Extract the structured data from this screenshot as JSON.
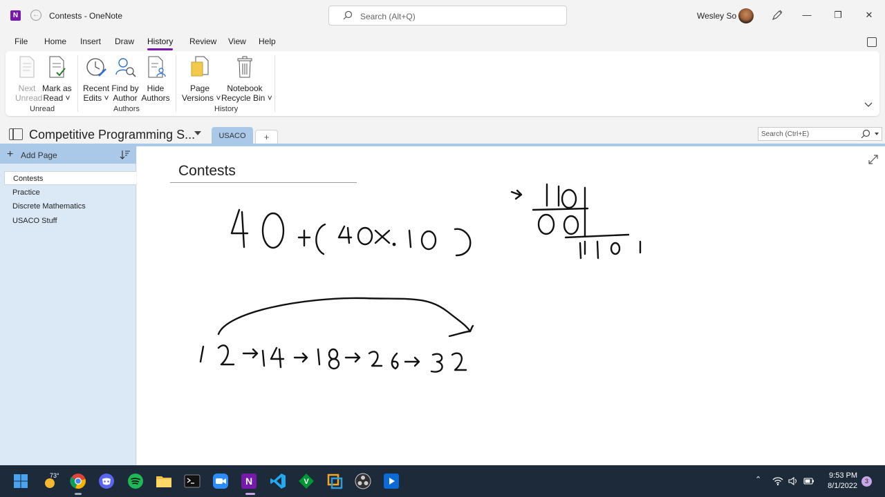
{
  "titlebar": {
    "app_icon_letter": "N",
    "title": "Contests  -  OneNote",
    "search_placeholder": "Search (Alt+Q)",
    "user_name": "Wesley So",
    "minimize": "—",
    "restore": "❐",
    "close": "✕"
  },
  "ribbon_tabs": [
    "File",
    "Home",
    "Insert",
    "Draw",
    "History",
    "Review",
    "View",
    "Help"
  ],
  "active_tab": "History",
  "ribbon": {
    "groups": [
      {
        "label": "Unread"
      },
      {
        "label": "Authors"
      },
      {
        "label": "History"
      }
    ],
    "buttons": {
      "next_unread": {
        "line1": "Next",
        "line2": "Unread",
        "enabled": false
      },
      "mark_as_read": {
        "line1": "Mark as",
        "line2": "Read ˅"
      },
      "recent_edits": {
        "line1": "Recent",
        "line2": "Edits ˅"
      },
      "find_by_author": {
        "line1": "Find by",
        "line2": "Author"
      },
      "hide_authors": {
        "line1": "Hide",
        "line2": "Authors"
      },
      "page_versions": {
        "line1": "Page",
        "line2": "Versions ˅"
      },
      "recycle_bin": {
        "line1": "Notebook",
        "line2": "Recycle Bin ˅"
      }
    }
  },
  "notebook": {
    "name": "Competitive Programming S...",
    "section_tab": "USACO",
    "add_section": "+",
    "search_placeholder": "Search (Ctrl+E)",
    "section_color": "#aac8e8"
  },
  "pagelist": {
    "add_page_label": "Add Page",
    "pages": [
      "Contests",
      "Practice",
      "Discrete Mathematics",
      "USACO Stuff"
    ],
    "selected_index": 0
  },
  "page": {
    "title": "Contests"
  },
  "taskbar": {
    "weather_temp": "73°",
    "time": "9:53 PM",
    "date": "8/1/2022",
    "notification_count": "3"
  },
  "colors": {
    "onenote_purple": "#7719aa",
    "taskbar_bg": "#1c2a3a"
  }
}
